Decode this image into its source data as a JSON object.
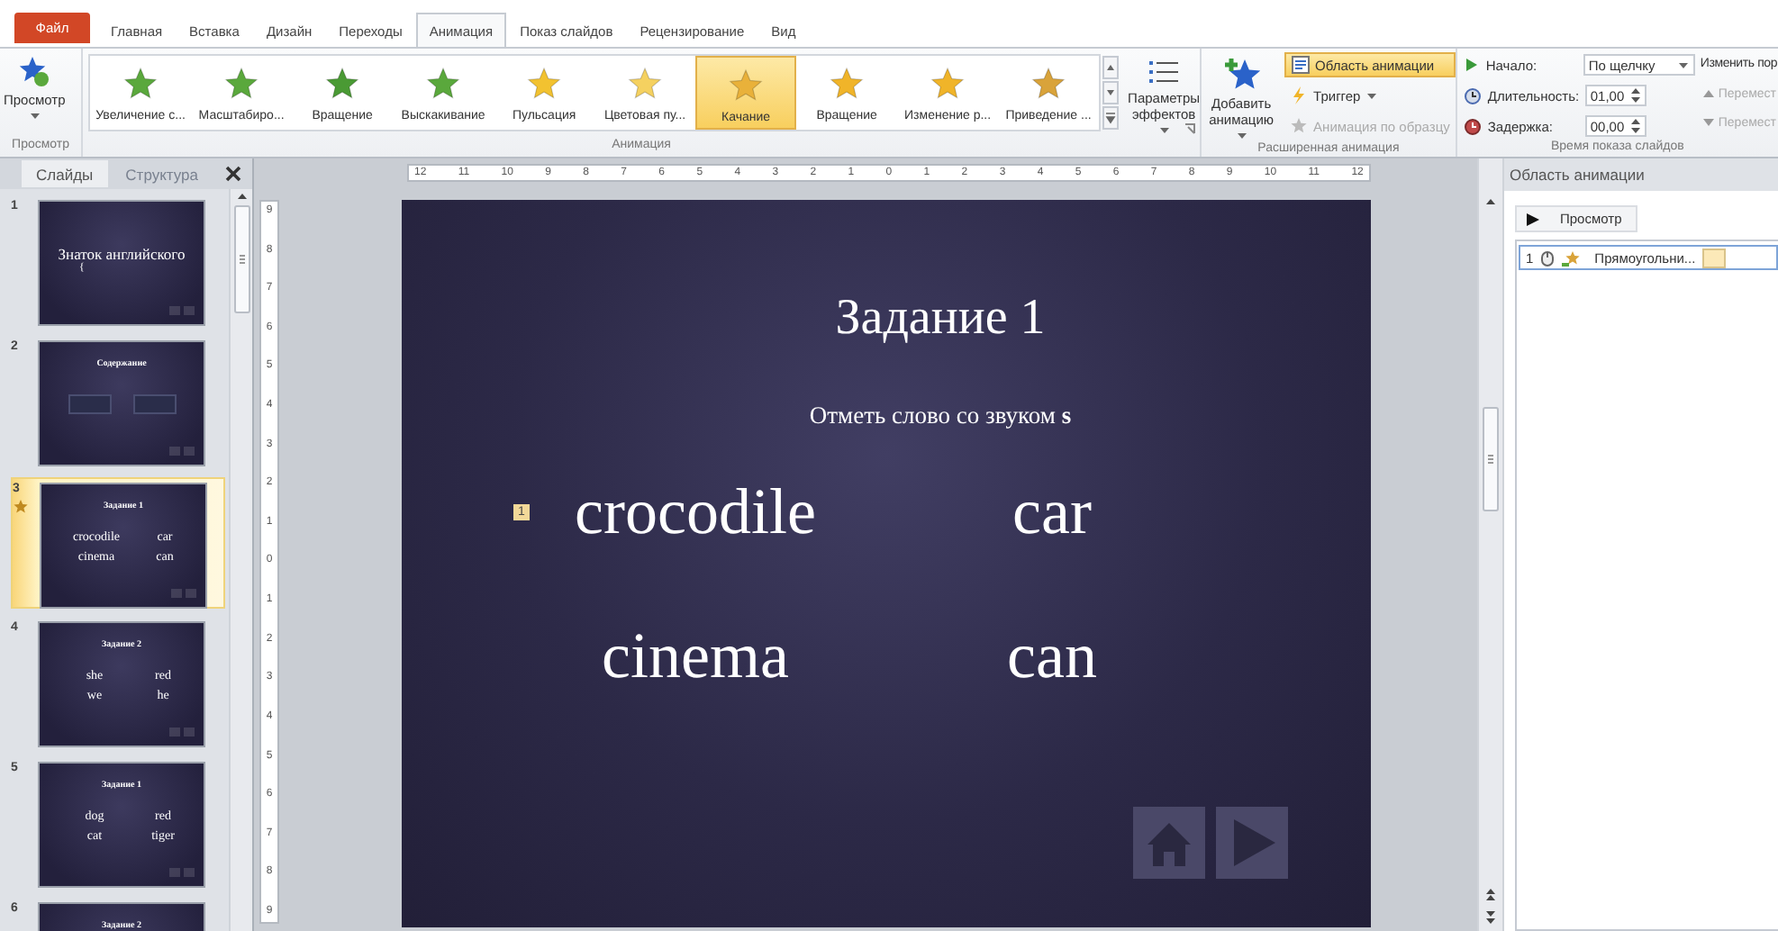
{
  "tabs": [
    {
      "label": "Файл",
      "kind": "file",
      "selected": false
    },
    {
      "label": "Главная",
      "kind": "tab",
      "selected": false
    },
    {
      "label": "Вставка",
      "kind": "tab",
      "selected": false
    },
    {
      "label": "Дизайн",
      "kind": "tab",
      "selected": false
    },
    {
      "label": "Переходы",
      "kind": "tab",
      "selected": false
    },
    {
      "label": "Анимация",
      "kind": "tab",
      "selected": true
    },
    {
      "label": "Показ слайдов",
      "kind": "tab",
      "selected": false
    },
    {
      "label": "Рецензирование",
      "kind": "tab",
      "selected": false
    },
    {
      "label": "Вид",
      "kind": "tab",
      "selected": false
    }
  ],
  "ribbon": {
    "preview": {
      "label": "Просмотр",
      "group": "Просмотр"
    },
    "gallery": {
      "group": "Анимация",
      "effects": [
        {
          "label": "Увеличение с...",
          "color": "#5aa83c",
          "selected": false
        },
        {
          "label": "Масштабиро...",
          "color": "#5aa83c",
          "selected": false
        },
        {
          "label": "Вращение",
          "color": "#4a9a34",
          "selected": false
        },
        {
          "label": "Выскакивание",
          "color": "#5aa83c",
          "selected": false
        },
        {
          "label": "Пульсация",
          "color": "#f2c230",
          "selected": false
        },
        {
          "label": "Цветовая пу...",
          "color": "#f5d160",
          "selected": false
        },
        {
          "label": "Качание",
          "color": "#e9b13a",
          "selected": true
        },
        {
          "label": "Вращение",
          "color": "#f0b429",
          "selected": false
        },
        {
          "label": "Изменение р...",
          "color": "#f0b429",
          "selected": false
        },
        {
          "label": "Приведение ...",
          "color": "#d9a33a",
          "selected": false
        }
      ]
    },
    "effect_options": {
      "label": "Параметры эффектов"
    },
    "advanced": {
      "group": "Расширенная анимация",
      "add": "Добавить анимацию",
      "pane": {
        "label": "Область анимации",
        "on": true
      },
      "trigger": {
        "label": "Триггер",
        "disabled": false
      },
      "painter": {
        "label": "Анимация по образцу",
        "disabled": true
      }
    },
    "timing": {
      "group": "Время показа слайдов",
      "start": {
        "label": "Начало:",
        "value": "По щелчку"
      },
      "duration": {
        "label": "Длительность:",
        "value": "01,00"
      },
      "delay": {
        "label": "Задержка:",
        "value": "00,00"
      },
      "reorder": "Изменить пор",
      "move_up": {
        "label": "Перемест",
        "disabled": true
      },
      "move_down": {
        "label": "Перемест",
        "disabled": true
      }
    }
  },
  "slides_panel": {
    "tabs": [
      {
        "label": "Слайды",
        "selected": true
      },
      {
        "label": "Структура",
        "selected": false
      }
    ],
    "thumbnails": [
      {
        "number": "1",
        "kind": "cover",
        "title": "Знаток английского",
        "subtitle": "{",
        "selected": false,
        "animated": false
      },
      {
        "number": "2",
        "kind": "menu",
        "title": "Содержание",
        "selected": false,
        "animated": false
      },
      {
        "number": "3",
        "kind": "words",
        "title": "Задание 1",
        "words": [
          "crocodile",
          "car",
          "cinema",
          "can"
        ],
        "selected": true,
        "animated": true
      },
      {
        "number": "4",
        "kind": "words",
        "title": "Задание 2",
        "words": [
          "she",
          "red",
          "we",
          "he"
        ],
        "selected": false,
        "animated": false
      },
      {
        "number": "5",
        "kind": "words",
        "title": "Задание 1",
        "words": [
          "dog",
          "red",
          "cat",
          "tiger"
        ],
        "selected": false,
        "animated": false
      },
      {
        "number": "6",
        "kind": "words",
        "title": "Задание 2",
        "selected": false,
        "animated": false
      }
    ]
  },
  "rulers": {
    "horizontal": [
      "12",
      "11",
      "10",
      "9",
      "8",
      "7",
      "6",
      "5",
      "4",
      "3",
      "2",
      "1",
      "0",
      "1",
      "2",
      "3",
      "4",
      "5",
      "6",
      "7",
      "8",
      "9",
      "10",
      "11",
      "12"
    ],
    "vertical": [
      "9",
      "8",
      "7",
      "6",
      "5",
      "4",
      "3",
      "2",
      "1",
      "0",
      "1",
      "2",
      "3",
      "4",
      "5",
      "6",
      "7",
      "8",
      "9"
    ]
  },
  "slide": {
    "title": "Задание 1",
    "subtitle": "Отметь слово со звуком **s**",
    "tag": "1",
    "words": [
      "crocodile",
      "car",
      "cinema",
      "can"
    ]
  },
  "animation_pane": {
    "title": "Область анимации",
    "play": "Просмотр",
    "items": [
      {
        "number": "1",
        "label": "Прямоугольни...",
        "selected": true
      }
    ]
  }
}
